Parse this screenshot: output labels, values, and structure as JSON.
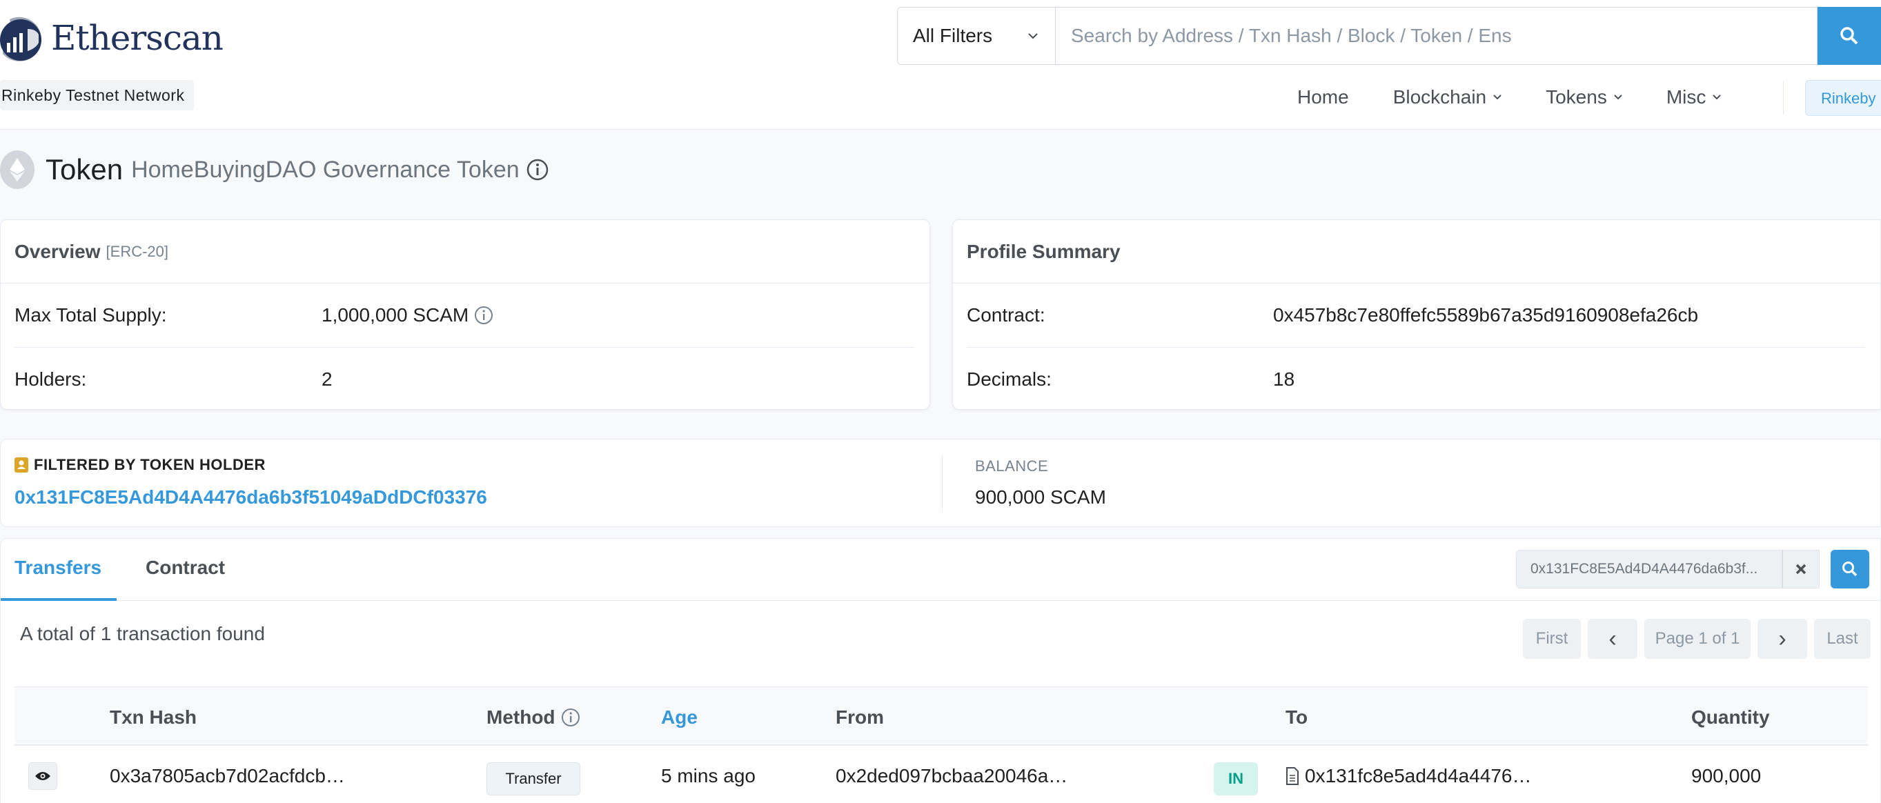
{
  "brand": {
    "name": "Etherscan",
    "network": "Rinkeby Testnet Network"
  },
  "search": {
    "filter_label": "All Filters",
    "placeholder": "Search by Address / Txn Hash / Block / Token / Ens"
  },
  "nav": {
    "home": "Home",
    "blockchain": "Blockchain",
    "tokens": "Tokens",
    "misc": "Misc",
    "chain": "Rinkeby"
  },
  "page": {
    "title": "Token",
    "subtitle": "HomeBuyingDAO Governance Token"
  },
  "overview": {
    "heading": "Overview",
    "tag": "[ERC-20]",
    "max_supply_label": "Max Total Supply:",
    "max_supply_value": "1,000,000 SCAM",
    "holders_label": "Holders:",
    "holders_value": "2"
  },
  "profile": {
    "heading": "Profile Summary",
    "contract_label": "Contract:",
    "contract_value": "0x457b8c7e80ffefc5589b67a35d9160908efa26cb",
    "decimals_label": "Decimals:",
    "decimals_value": "18"
  },
  "filter": {
    "label": "FILTERED BY TOKEN HOLDER",
    "address": "0x131FC8E5Ad4D4A4476da6b3f51049aDdDCf03376",
    "balance_label": "BALANCE",
    "balance_value": "900,000 SCAM"
  },
  "tabs": {
    "transfers": "Transfers",
    "contract": "Contract"
  },
  "holder_filter": {
    "value": "0x131FC8E5Ad4D4A4476da6b3f..."
  },
  "summary": "A total of 1 transaction found",
  "pager": {
    "first": "First",
    "prev": "‹",
    "page": "Page 1 of 1",
    "next": "›",
    "last": "Last"
  },
  "table": {
    "headers": {
      "hash": "Txn Hash",
      "method": "Method",
      "age": "Age",
      "from": "From",
      "to": "To",
      "quantity": "Quantity"
    },
    "rows": [
      {
        "hash": "0x3a7805acb7d02acfdcb…",
        "method": "Transfer",
        "age": "5 mins ago",
        "from": "0x2ded097bcbaa20046a…",
        "direction": "IN",
        "to": "0x131fc8e5ad4d4a4476…",
        "quantity": "900,000"
      }
    ]
  },
  "colors": {
    "accent": "#3498db",
    "brand_dark": "#21325b",
    "in_badge": "#00a186"
  }
}
